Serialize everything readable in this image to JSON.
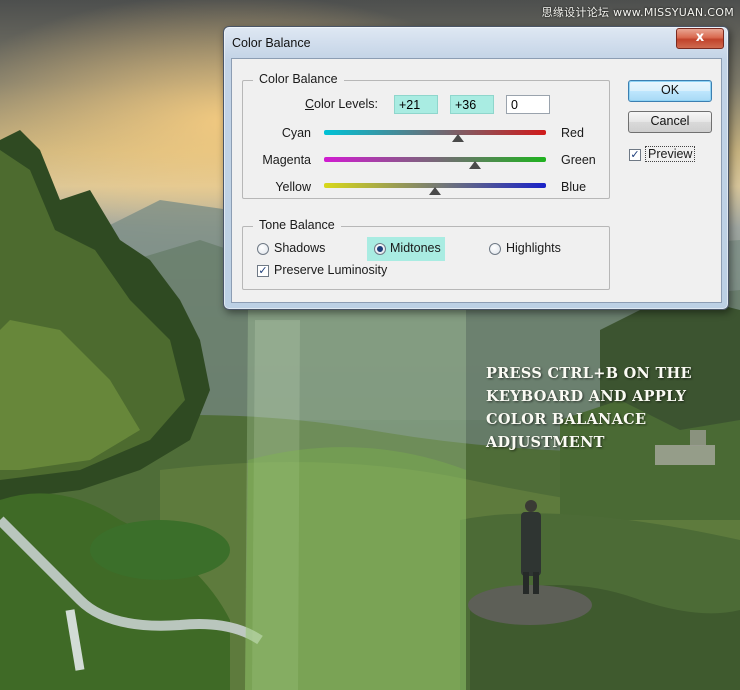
{
  "watermark": "思缘设计论坛 www.MISSYUAN.COM",
  "caption": [
    "PRESS CTRL+B ON THE",
    "KEYBOARD AND APPLY",
    "COLOR BALANACE",
    "ADJUSTMENT"
  ],
  "dialog": {
    "title": "Color Balance",
    "close_label": "x",
    "color_balance": {
      "group_title": "Color Balance",
      "levels_label": "Color Levels:",
      "levels": [
        "+21",
        "+36",
        "0"
      ],
      "sliders": [
        {
          "left": "Cyan",
          "right": "Red",
          "value": 21,
          "min": -100,
          "max": 100
        },
        {
          "left": "Magenta",
          "right": "Green",
          "value": 36,
          "min": -100,
          "max": 100
        },
        {
          "left": "Yellow",
          "right": "Blue",
          "value": 0,
          "min": -100,
          "max": 100
        }
      ]
    },
    "tone_balance": {
      "group_title": "Tone Balance",
      "shadows": "Shadows",
      "midtones": "Midtones",
      "highlights": "Highlights",
      "selected": "Midtones",
      "preserve_luminosity": "Preserve Luminosity",
      "preserve_checked": true
    },
    "buttons": {
      "ok": "OK",
      "cancel": "Cancel",
      "preview": "Preview",
      "preview_checked": true
    }
  },
  "colors": {
    "highlight": "#a9ece2",
    "title_gradient": "#c7d6e8"
  }
}
